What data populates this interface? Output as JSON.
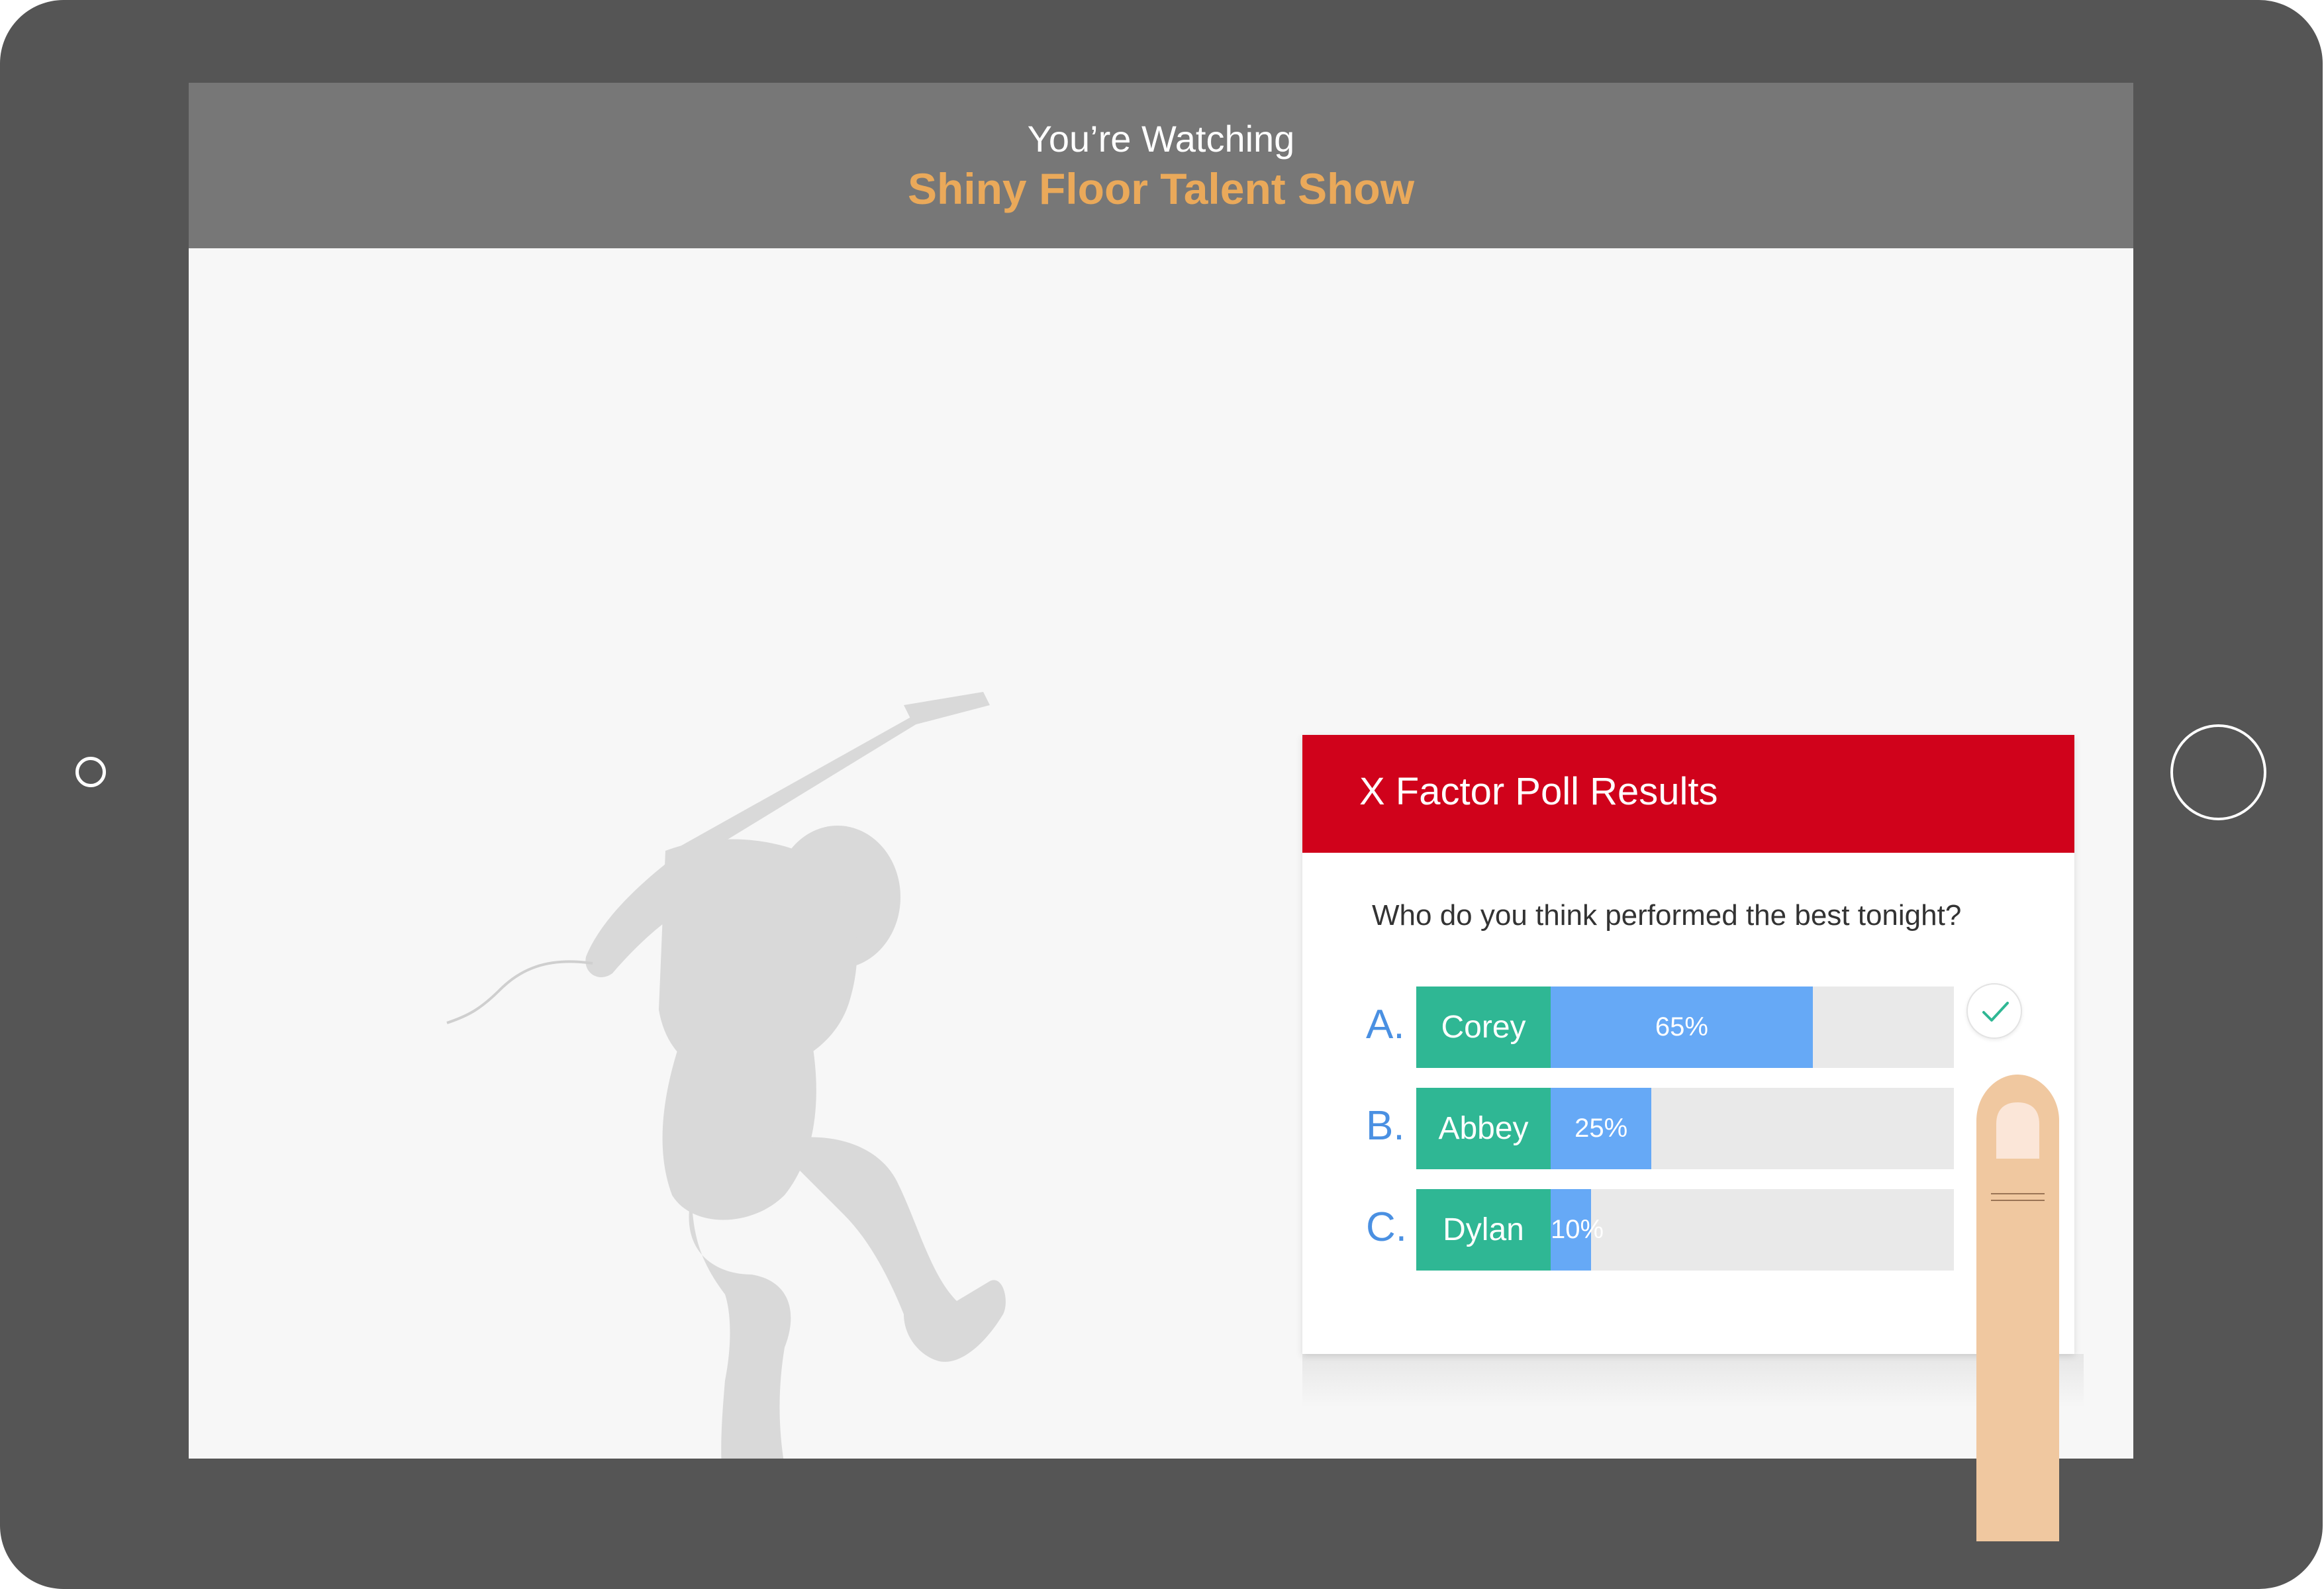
{
  "header": {
    "subtitle": "You’re Watching",
    "title": "Shiny Floor Talent Show"
  },
  "poll": {
    "title": "X Factor Poll Results",
    "question": "Who do you think performed the best tonight?",
    "options": [
      {
        "letter": "A.",
        "name": "Corey",
        "percent_label": "65%",
        "percent": 65,
        "selected": true
      },
      {
        "letter": "B.",
        "name": "Abbey",
        "percent_label": "25%",
        "percent": 25,
        "selected": false
      },
      {
        "letter": "C.",
        "name": "Dylan",
        "percent_label": "10%",
        "percent": 10,
        "selected": false
      }
    ]
  },
  "icons": {
    "check": "check-icon",
    "home_button_left": "home-button-icon",
    "home_button_right": "home-button-icon",
    "performer": "guitarist-silhouette",
    "finger": "finger-pointer"
  },
  "colors": {
    "device_frame": "#555555",
    "header_bg": "#777777",
    "title_accent": "#eaa95a",
    "poll_header_bg": "#d0021b",
    "option_name_bg": "#2fb794",
    "option_fill": "#66a9f6",
    "option_track": "#e9e9e9",
    "option_letter": "#4a90e2",
    "check": "#2fb794"
  }
}
